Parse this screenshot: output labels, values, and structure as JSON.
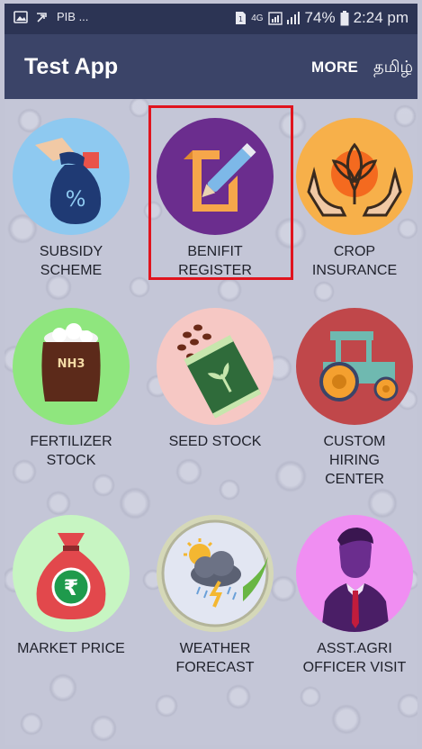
{
  "status_bar": {
    "left_text": "PIB ...",
    "network": "4G",
    "battery": "74%",
    "time": "2:24 pm",
    "icons": [
      "gallery-icon",
      "cast-icon",
      "sim-icon",
      "signal-icon",
      "battery-icon"
    ]
  },
  "app_bar": {
    "title": "Test App",
    "more_label": "MORE",
    "language_label": "தமிழ்"
  },
  "colors": {
    "status_bar": "#2c3454",
    "app_bar": "#3b4468",
    "background": "#c4c6d7",
    "highlight": "#e0141e"
  },
  "tiles": [
    {
      "label_line1": "SUBSIDY",
      "label_line2": "SCHEME",
      "label_line3": "",
      "icon": "money-bag-percent-icon",
      "color": "#8ec9f0"
    },
    {
      "label_line1": "BENIFIT",
      "label_line2": "REGISTER",
      "label_line3": "",
      "icon": "edit-document-icon",
      "color": "#6b2d8e",
      "highlighted": true
    },
    {
      "label_line1": "CROP",
      "label_line2": "INSURANCE",
      "label_line3": "",
      "icon": "hands-plant-icon",
      "color": "#f7b04a"
    },
    {
      "label_line1": "FERTILIZER",
      "label_line2": "STOCK",
      "label_line3": "",
      "icon": "fertilizer-bag-icon",
      "color": "#8fe67e"
    },
    {
      "label_line1": "SEED STOCK",
      "label_line2": "",
      "label_line3": "",
      "icon": "seed-packet-icon",
      "color": "#f6c8c4"
    },
    {
      "label_line1": "CUSTOM",
      "label_line2": "HIRING",
      "label_line3": "CENTER",
      "icon": "tractor-icon",
      "color": "#c0474a"
    },
    {
      "label_line1": "MARKET PRICE",
      "label_line2": "",
      "label_line3": "",
      "icon": "rupee-bag-icon",
      "color": "#c7f5c2"
    },
    {
      "label_line1": "WEATHER",
      "label_line2": "FORECAST",
      "label_line3": "",
      "icon": "weather-storm-icon",
      "color": "#d5d8b8"
    },
    {
      "label_line1": "ASST.AGRI",
      "label_line2": "OFFICER VISIT",
      "label_line3": "",
      "icon": "officer-avatar-icon",
      "color": "#f08ef2"
    }
  ]
}
